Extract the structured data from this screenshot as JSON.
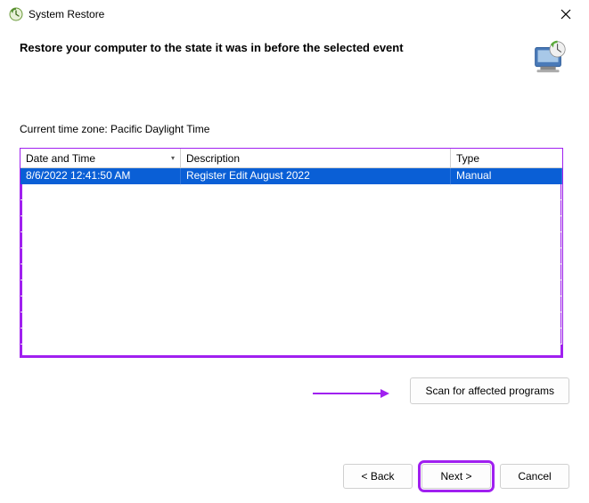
{
  "titlebar": {
    "title": "System Restore"
  },
  "header": {
    "heading": "Restore your computer to the state it was in before the selected event"
  },
  "timezone_label": "Current time zone: Pacific Daylight Time",
  "table": {
    "columns": {
      "date": "Date and Time",
      "description": "Description",
      "type": "Type"
    },
    "rows": [
      {
        "date": "8/6/2022 12:41:50 AM",
        "description": "Register Edit August 2022",
        "type": "Manual",
        "selected": true
      }
    ]
  },
  "buttons": {
    "scan": "Scan for affected programs",
    "back": "< Back",
    "next": "Next >",
    "cancel": "Cancel"
  },
  "annotations": {
    "highlight_color": "#a020f0"
  }
}
